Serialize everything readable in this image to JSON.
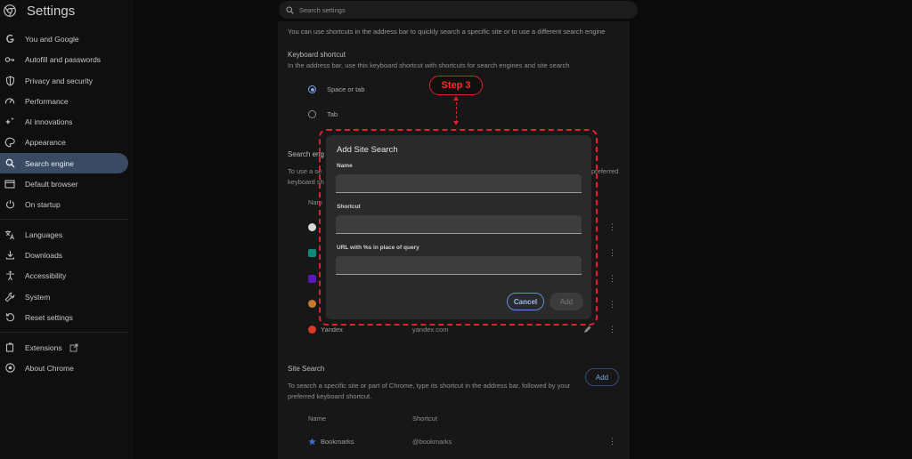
{
  "app": {
    "title": "Settings"
  },
  "search": {
    "placeholder": "Search settings"
  },
  "sidebar": {
    "items": [
      {
        "label": "You and Google",
        "icon": "google-icon"
      },
      {
        "label": "Autofill and passwords",
        "icon": "key-icon"
      },
      {
        "label": "Privacy and security",
        "icon": "shield-icon"
      },
      {
        "label": "Performance",
        "icon": "speedometer-icon"
      },
      {
        "label": "AI innovations",
        "icon": "sparkle-icon"
      },
      {
        "label": "Appearance",
        "icon": "palette-icon"
      },
      {
        "label": "Search engine",
        "icon": "search-icon",
        "active": true
      },
      {
        "label": "Default browser",
        "icon": "browser-icon"
      },
      {
        "label": "On startup",
        "icon": "power-icon"
      },
      {
        "label": "Languages",
        "icon": "translate-icon"
      },
      {
        "label": "Downloads",
        "icon": "download-icon"
      },
      {
        "label": "Accessibility",
        "icon": "accessibility-icon"
      },
      {
        "label": "System",
        "icon": "wrench-icon"
      },
      {
        "label": "Reset settings",
        "icon": "reset-icon"
      },
      {
        "label": "Extensions",
        "icon": "puzzle-icon"
      },
      {
        "label": "About Chrome",
        "icon": "chrome-icon"
      }
    ]
  },
  "main": {
    "intro": "You can use shortcuts in the address bar to quickly search a specific site or to use a different search engine",
    "keyboard_shortcut": {
      "heading": "Keyboard shortcut",
      "description": "In the address bar, use this keyboard shortcut with shortcuts for search engines and site search",
      "options": [
        {
          "label": "Space or tab",
          "selected": true
        },
        {
          "label": "Tab",
          "selected": false
        }
      ]
    },
    "search_engines": {
      "heading_partial": "Search eng",
      "desc_partial_1": "To use a se",
      "desc_partial_2": "keyboard sh",
      "desc_right": "preferred",
      "col_partial": "Nam",
      "rows": [
        {
          "name": "Yandex",
          "url": "yandex.com"
        }
      ]
    },
    "site_search": {
      "heading": "Site Search",
      "description_1": "To search a specific site or part of Chrome, type its shortcut in the address bar, followed by your",
      "description_2": "preferred keyboard shortcut.",
      "add_label": "Add",
      "columns": [
        "Name",
        "Shortcut"
      ],
      "rows": [
        {
          "name": "Bookmarks",
          "shortcut": "@bookmarks"
        }
      ]
    }
  },
  "dialog": {
    "title": "Add Site Search",
    "fields": [
      {
        "label": "Name",
        "value": ""
      },
      {
        "label": "Shortcut",
        "value": ""
      },
      {
        "label": "URL with %s in place of query",
        "value": ""
      }
    ],
    "cancel_label": "Cancel",
    "add_label": "Add"
  },
  "annotation": {
    "step_label": "Step 3",
    "color": "#e0202c"
  },
  "colors": {
    "accent": "#7aa2e8",
    "active_bg": "#3a4a62"
  }
}
